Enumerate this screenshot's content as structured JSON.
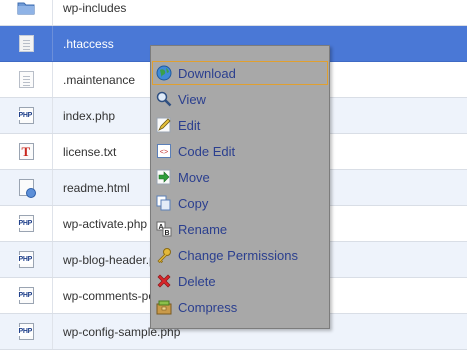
{
  "files": [
    {
      "name": "wp-includes",
      "icon": "folder-icon"
    },
    {
      "name": ".htaccess",
      "icon": "document-icon",
      "selected": true
    },
    {
      "name": ".maintenance",
      "icon": "document-icon"
    },
    {
      "name": "index.php",
      "icon": "php-file-icon"
    },
    {
      "name": "license.txt",
      "icon": "text-file-icon"
    },
    {
      "name": "readme.html",
      "icon": "html-file-icon"
    },
    {
      "name": "wp-activate.php",
      "icon": "php-file-icon"
    },
    {
      "name": "wp-blog-header.php",
      "icon": "php-file-icon"
    },
    {
      "name": "wp-comments-post.php",
      "icon": "php-file-icon"
    },
    {
      "name": "wp-config-sample.php",
      "icon": "php-file-icon"
    }
  ],
  "context_menu": {
    "items": [
      {
        "label": "Download",
        "icon": "globe-download-icon",
        "hovered": true
      },
      {
        "label": "View",
        "icon": "magnifier-icon"
      },
      {
        "label": "Edit",
        "icon": "pencil-icon"
      },
      {
        "label": "Code Edit",
        "icon": "code-icon"
      },
      {
        "label": "Move",
        "icon": "arrow-right-icon"
      },
      {
        "label": "Copy",
        "icon": "copy-icon"
      },
      {
        "label": "Rename",
        "icon": "rename-icon"
      },
      {
        "label": "Change Permissions",
        "icon": "key-icon"
      },
      {
        "label": "Delete",
        "icon": "red-x-icon"
      },
      {
        "label": "Compress",
        "icon": "archive-icon"
      }
    ]
  },
  "colors": {
    "selected_row": "#4a78d6",
    "alt_row": "#eef3fb",
    "menu_background": "#a8a8a8",
    "menu_text": "#2b3f8f",
    "hover_border": "#e0a030"
  }
}
